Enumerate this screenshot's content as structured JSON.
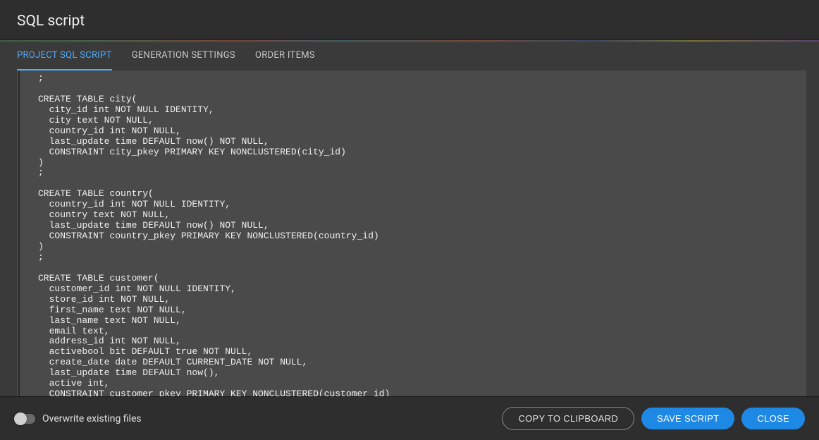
{
  "header": {
    "title": "SQL script"
  },
  "tabs": [
    {
      "label": "PROJECT SQL SCRIPT",
      "active": true
    },
    {
      "label": "GENERATION SETTINGS",
      "active": false
    },
    {
      "label": "ORDER ITEMS",
      "active": false
    }
  ],
  "code": {
    "lines": [
      ";",
      "",
      "CREATE TABLE city(",
      "  city_id int NOT NULL IDENTITY,",
      "  city text NOT NULL,",
      "  country_id int NOT NULL,",
      "  last_update time DEFAULT now() NOT NULL,",
      "  CONSTRAINT city_pkey PRIMARY KEY NONCLUSTERED(city_id)",
      ")",
      ";",
      "",
      "CREATE TABLE country(",
      "  country_id int NOT NULL IDENTITY,",
      "  country text NOT NULL,",
      "  last_update time DEFAULT now() NOT NULL,",
      "  CONSTRAINT country_pkey PRIMARY KEY NONCLUSTERED(country_id)",
      ")",
      ";",
      "",
      "CREATE TABLE customer(",
      "  customer_id int NOT NULL IDENTITY,",
      "  store_id int NOT NULL,",
      "  first_name text NOT NULL,",
      "  last_name text NOT NULL,",
      "  email text,",
      "  address_id int NOT NULL,",
      "  activebool bit DEFAULT true NOT NULL,",
      "  create_date date DEFAULT CURRENT_DATE NOT NULL,",
      "  last_update time DEFAULT now(),",
      "  active int,",
      "  CONSTRAINT customer_pkey PRIMARY KEY NONCLUSTERED(customer_id)",
      ")",
      ";"
    ]
  },
  "footer": {
    "overwrite_label": "Overwrite existing files",
    "overwrite_checked": false,
    "copy_label": "COPY TO CLIPBOARD",
    "save_label": "SAVE SCRIPT",
    "close_label": "CLOSE"
  }
}
